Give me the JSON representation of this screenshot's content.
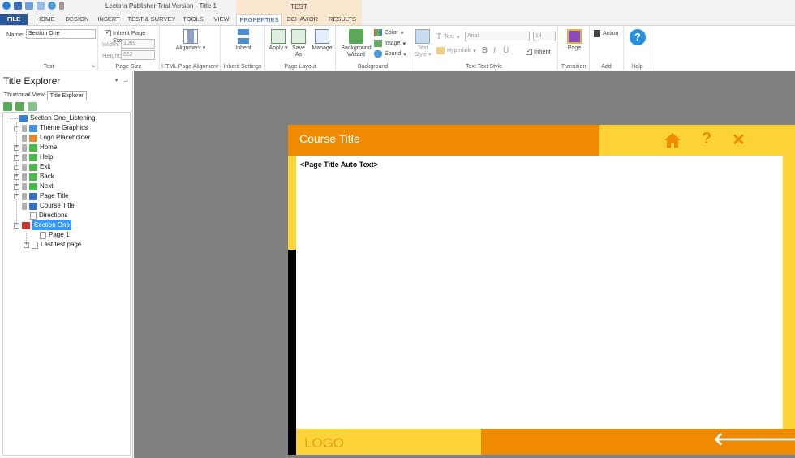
{
  "window": {
    "app_title": "Lectora Publisher Trial Version - Title 1",
    "context_group": "TEST"
  },
  "tabs": [
    "FILE",
    "HOME",
    "DESIGN",
    "INSERT",
    "TEST & SURVEY",
    "TOOLS",
    "VIEW",
    "PROPERTIES",
    "BEHAVIOR",
    "RESULTS"
  ],
  "active_tab": "PROPERTIES",
  "ribbon": {
    "test_group": {
      "name_label": "Name:",
      "name_value": "Section One",
      "label": "Test"
    },
    "page_size": {
      "inherit_label": "Inherit Page Size",
      "inherit_checked": true,
      "width_label": "Width:",
      "width_value": "1009",
      "height_label": "Height:",
      "height_value": "662",
      "label": "Page Size"
    },
    "alignment": {
      "button": "Alignment",
      "label": "HTML Page Alignment"
    },
    "inherit": {
      "button": "Inherit",
      "label": "Inherit Settings"
    },
    "layout": {
      "apply": "Apply",
      "save_as": "Save As",
      "manage": "Manage",
      "label": "Page Layout"
    },
    "background": {
      "wizard": "Background Wizard",
      "color": "Color",
      "image": "Image",
      "sound": "Sound",
      "label": "Background"
    },
    "text_style": {
      "text_style_btn": "Text Style",
      "text": "Text",
      "hyperlink": "Hyperlink",
      "font": "Arial",
      "size": "14",
      "bold": "B",
      "italic": "I",
      "underline": "U",
      "inherit": "Inherit",
      "label": "Text Text Style"
    },
    "transition": {
      "button": "Page",
      "label": "Transition"
    },
    "add": {
      "button": "Action",
      "label": "Add"
    },
    "help": {
      "label": "Help"
    }
  },
  "left_panel": {
    "title": "Title Explorer",
    "tabs": [
      "Thumbnail View",
      "Title Explorer"
    ],
    "active_tab": "Title Explorer",
    "tree": [
      {
        "label": "Section One_Listening",
        "icon": "section-icon"
      },
      {
        "label": "Theme Graphics",
        "icon": "group-icon"
      },
      {
        "label": "Logo Placeholder",
        "icon": "image-icon"
      },
      {
        "label": "Home",
        "icon": "button-icon"
      },
      {
        "label": "Help",
        "icon": "button-icon"
      },
      {
        "label": "Exit",
        "icon": "button-icon"
      },
      {
        "label": "Back",
        "icon": "button-icon"
      },
      {
        "label": "Next",
        "icon": "button-icon"
      },
      {
        "label": "Page Title",
        "icon": "text-icon"
      },
      {
        "label": "Course Title",
        "icon": "text-icon"
      },
      {
        "label": "Directions",
        "icon": "page-icon"
      },
      {
        "label": "Section One",
        "icon": "test-icon",
        "selected": true
      },
      {
        "label": "Page 1",
        "icon": "page-icon"
      },
      {
        "label": "Last test page",
        "icon": "page-icon"
      }
    ]
  },
  "stage": {
    "course_title": "Course Title",
    "page_title_text": "<Page Title Auto Text>",
    "logo": "LOGO",
    "nav_icons": [
      "home-icon",
      "help-icon",
      "close-icon",
      "back-arrow-icon",
      "next-arrow-icon"
    ]
  },
  "colors": {
    "brand_orange": "#f08a00",
    "brand_yellow": "#fcd336",
    "file_tab_blue": "#2a579a",
    "selection_blue": "#3399ff",
    "canvas_gray": "#808080"
  }
}
